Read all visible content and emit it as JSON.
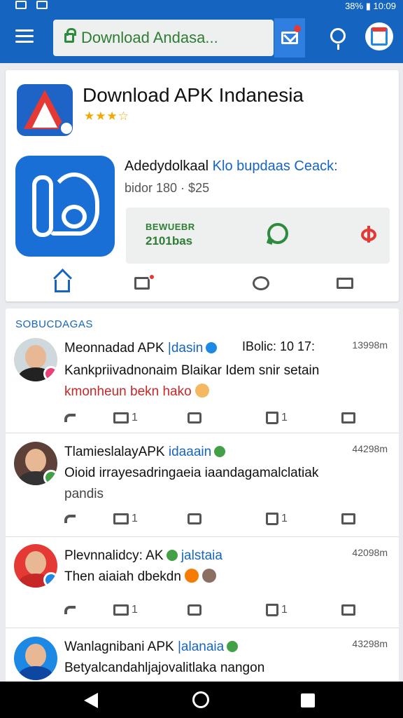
{
  "statusbar": {
    "left_icons": [
      "notification-icon",
      "image-icon"
    ],
    "right_text": "38% ▮ 10:09"
  },
  "appbar": {
    "search_text": "Download Andasa...",
    "icons": [
      "menu-icon",
      "lock-icon",
      "mail-icon",
      "location-pin-icon",
      "avatar"
    ]
  },
  "app": {
    "title": "Download APK Indanesia",
    "stars": "★★★☆",
    "desc_main": "Adedydolkaal",
    "desc_highlight": "Klo bupdaas Ceack:",
    "desc_sub": "bidor 180 · $25",
    "download_label": "BEWUEBR",
    "download_count": "2101bas",
    "tab_icons": [
      "home-icon",
      "inbox-icon",
      "chat-icon",
      "mail-icon"
    ]
  },
  "feed": {
    "header": "SOBUCDAGAS",
    "posts": [
      {
        "name": "Meonnadad APK",
        "tag": "|dasin",
        "time_prefix": "IBolic: 10 17:",
        "time": "13998m",
        "line1": "Kankpriivadnonaim Blaikar Idem snir setain",
        "line2": "kmonheun bekn hako",
        "retweets": "1",
        "likes": "1"
      },
      {
        "name": "TlamieslalayAPK",
        "tag": "idaaain",
        "time": "44298m",
        "line1": "Oioid irrayesadringaeia iaandagamalclatiak",
        "line2": "pandis",
        "retweets": "1",
        "likes": "1"
      },
      {
        "name": "Plevnnalidcy: AK",
        "tag": "jalstaia",
        "time": "42098m",
        "line1": "Then aiaiah dbekdn",
        "line2": "",
        "retweets": "1",
        "likes": "1"
      },
      {
        "name": "Wanlagnibani APK",
        "tag": "|alanaia",
        "time": "43298m",
        "line1": "Betyalcandahljajovalitlaka nangon",
        "line2": "",
        "retweets": "",
        "likes": ""
      }
    ]
  },
  "colors": {
    "primary": "#1565c0",
    "accent_green": "#2e7d32",
    "alert_red": "#e53935"
  }
}
